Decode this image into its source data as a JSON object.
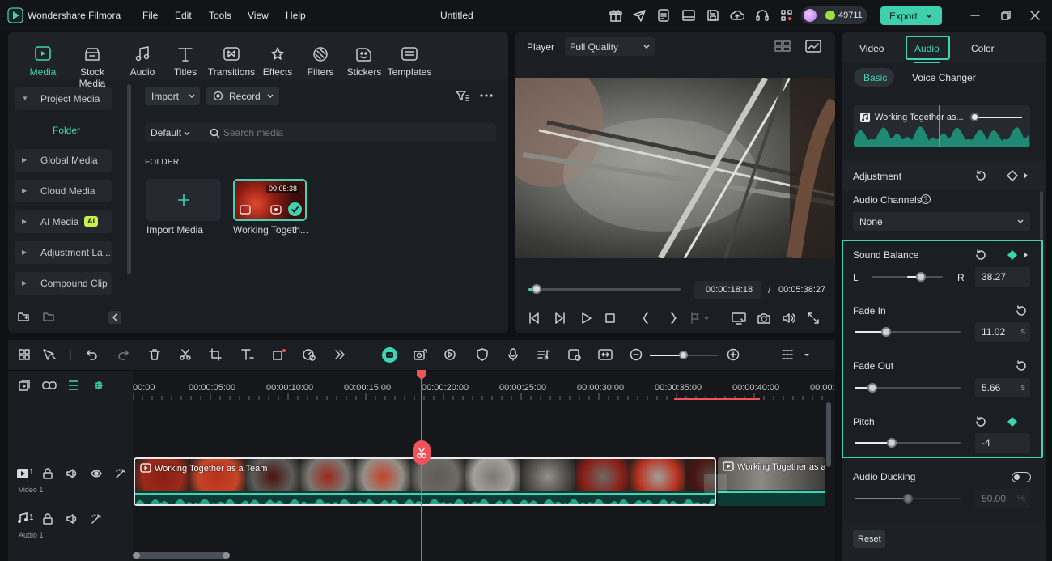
{
  "app": {
    "name": "Wondershare Filmora",
    "title": "Untitled"
  },
  "menu": [
    "File",
    "Edit",
    "Tools",
    "View",
    "Help"
  ],
  "header": {
    "credits": "49711",
    "export_label": "Export"
  },
  "toolbar": [
    {
      "label": "Media",
      "icon": "media-icon"
    },
    {
      "label": "Stock Media",
      "icon": "stock-media-icon"
    },
    {
      "label": "Audio",
      "icon": "audio-icon"
    },
    {
      "label": "Titles",
      "icon": "titles-icon"
    },
    {
      "label": "Transitions",
      "icon": "transitions-icon"
    },
    {
      "label": "Effects",
      "icon": "effects-icon"
    },
    {
      "label": "Filters",
      "icon": "filters-icon"
    },
    {
      "label": "Stickers",
      "icon": "stickers-icon"
    },
    {
      "label": "Templates",
      "icon": "templates-icon"
    }
  ],
  "sidebar": {
    "project_media": "Project Media",
    "folder": "Folder",
    "items": [
      "Global Media",
      "Cloud Media",
      "AI Media",
      "Adjustment La...",
      "Compound Clip"
    ],
    "ai_badge": "AI"
  },
  "media": {
    "import_label": "Import",
    "record_label": "Record",
    "sort_label": "Default",
    "search_placeholder": "Search media",
    "folder_heading": "FOLDER",
    "import_media_label": "Import Media",
    "clip_name": "Working Togeth...",
    "clip_duration": "00:05:38"
  },
  "player": {
    "label": "Player",
    "quality": "Full Quality",
    "current_time": "00:00:18:18",
    "separator": "/",
    "total_time": "00:05:38:27",
    "progress": 0.055
  },
  "inspector": {
    "tabs": [
      "Video",
      "Audio",
      "Color"
    ],
    "active_tab": "Audio",
    "subtabs": [
      "Basic",
      "Voice Changer"
    ],
    "track_name": "Working Together as...",
    "adjustment": "Adjustment",
    "audio_channels_label": "Audio Channels",
    "audio_channels_value": "None",
    "sound_balance": {
      "label": "Sound Balance",
      "left": "L",
      "right": "R",
      "value": "38.27",
      "fraction": 0.69
    },
    "fade_in": {
      "label": "Fade In",
      "value": "11.02",
      "unit": "s",
      "fraction": 0.3
    },
    "fade_out": {
      "label": "Fade Out",
      "value": "5.66",
      "unit": "s",
      "fraction": 0.17
    },
    "pitch": {
      "label": "Pitch",
      "value": "-4",
      "fraction": 0.35
    },
    "audio_ducking": {
      "label": "Audio Ducking",
      "value": "50.00",
      "unit": "%",
      "fraction": 0.5
    },
    "reset_label": "Reset"
  },
  "timeline": {
    "ruler": [
      "00:00",
      "00:00:05:00",
      "00:00:10:00",
      "00:00:15:00",
      "00:00:20:00",
      "00:00:25:00",
      "00:00:30:00",
      "00:00:35:00",
      "00:00:40:00",
      "00:00:"
    ],
    "video_track_label": "Video 1",
    "audio_track_label": "Audio 1",
    "video_track_index": "1",
    "audio_track_index": "1",
    "clip1_title": "Working Together as a Team",
    "clip2_title": "Working Together as a"
  },
  "colors": {
    "accent": "#3fd3b4",
    "export_bg": "#3ecfae",
    "playhead": "#f0525a"
  }
}
